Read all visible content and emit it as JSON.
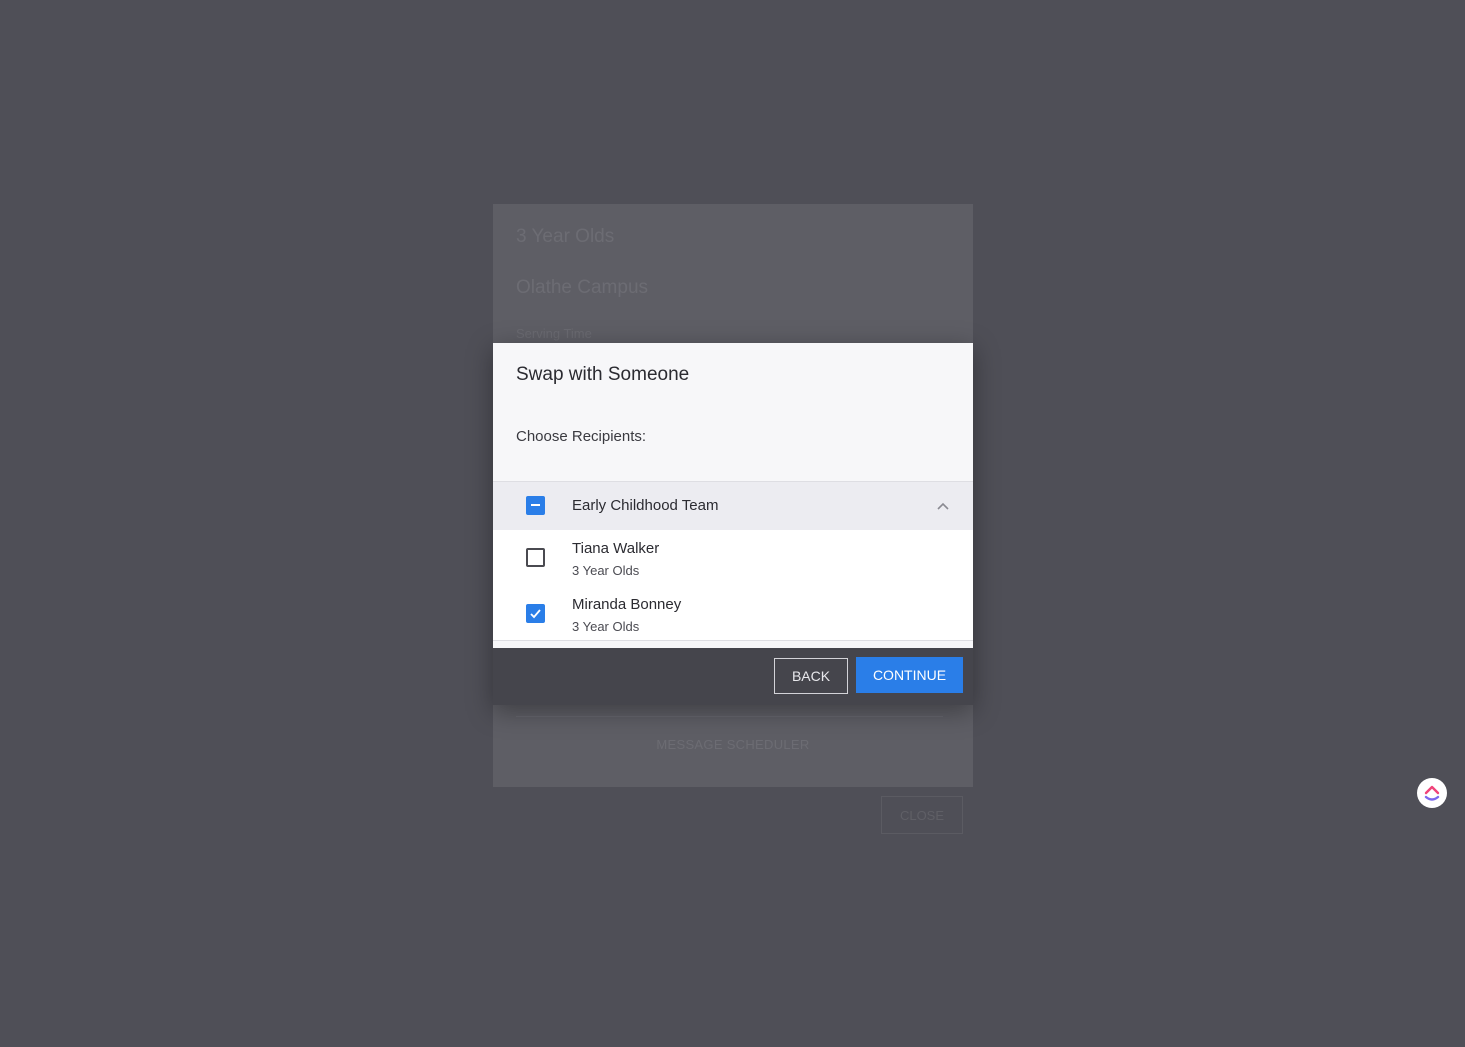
{
  "background": {
    "title": "3 Year Olds",
    "campus": "Olathe Campus",
    "subheading": "Serving Time",
    "scheduler_label": "MESSAGE SCHEDULER",
    "close_label": "CLOSE"
  },
  "modal": {
    "title": "Swap with Someone",
    "recipients_label": "Choose Recipients:",
    "group": {
      "label": "Early Childhood Team",
      "state": "indeterminate",
      "expanded": true
    },
    "members": [
      {
        "name": "Tiana Walker",
        "role": "3 Year Olds",
        "checked": false
      },
      {
        "name": "Miranda Bonney",
        "role": "3 Year Olds",
        "checked": true
      }
    ],
    "back_label": "BACK",
    "continue_label": "CONTINUE"
  },
  "colors": {
    "accent": "#2a7ee8",
    "overlay": "#4f4f57"
  },
  "widget": {
    "icon": "clickup-logo-icon"
  }
}
